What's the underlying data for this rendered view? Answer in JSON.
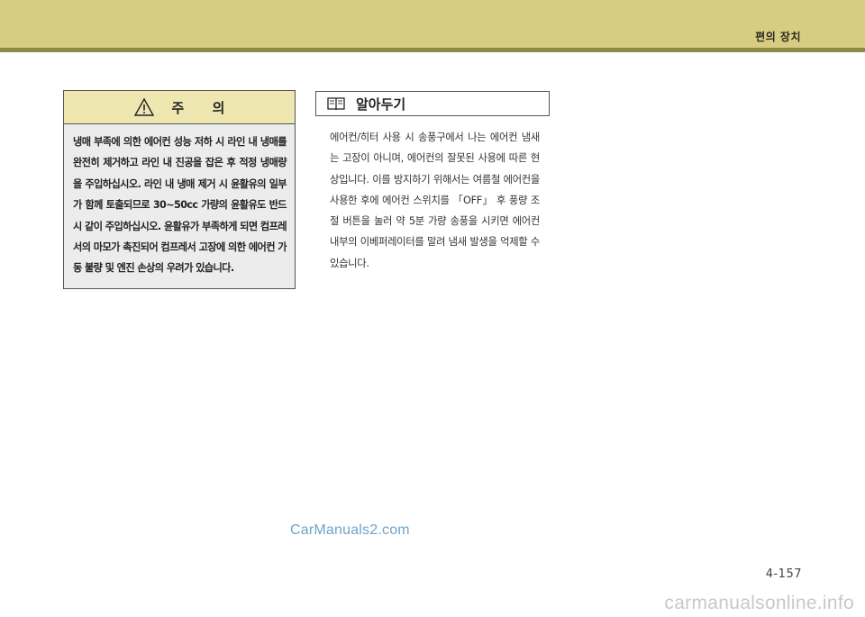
{
  "header": {
    "section_title": "편의 장치"
  },
  "caution": {
    "title": "주      의",
    "icon": "warning-triangle-icon",
    "body": "냉매 부족에 의한 에어컨 성능 저하 시 라인 내 냉매를 완전히 제거하고 라인 내 진공을 잡은 후 적정 냉매량을 주입하십시오. 라인 내 냉매 제거 시 윤활유의 일부가 함께 토출되므로 30~50cc 가량의 윤활유도 반드시 같이 주입하십시오. 윤활유가 부족하게 되면 컴프레서의 마모가 촉진되어 컴프레서 고장에 의한 에어컨 가동 불량 및 엔진 손상의 우려가 있습니다."
  },
  "note": {
    "title": "알아두기",
    "icon": "book-icon",
    "body": "에어컨/히터 사용 시 송풍구에서 나는 에어컨 냄새는 고장이 아니며, 에어컨의 잘못된 사용에 따른 현상입니다. 이를 방지하기 위해서는 여름철 에어컨을 사용한 후에 에어컨 스위치를 「OFF」 후 풍량 조절 버튼을 눌러 약 5분 가량 송풍을 시키면 에어컨 내부의 이베퍼레이터를 말려 냄새 발생을 억제할 수 있습니다."
  },
  "watermark": "CarManuals2.com",
  "page_number": "4-157",
  "footer_watermark": "carmanualsonline.info",
  "colors": {
    "top_band": "#d8cc82",
    "top_rule": "#8c8a45",
    "caution_header": "#efe7b0",
    "caution_body": "#ececec"
  }
}
